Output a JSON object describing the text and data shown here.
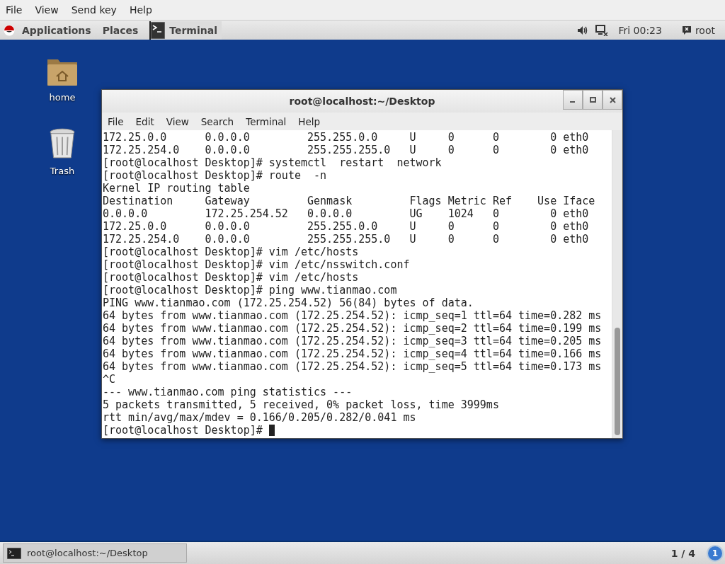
{
  "viewer_menu": [
    "File",
    "View",
    "Send key",
    "Help"
  ],
  "panel": {
    "applications": "Applications",
    "places": "Places",
    "active_app": "Terminal",
    "clock": "Fri 00:23",
    "user": "root"
  },
  "desktop_icons": [
    {
      "label": "home",
      "kind": "folder"
    },
    {
      "label": "Trash",
      "kind": "trash"
    }
  ],
  "terminal": {
    "title": "root@localhost:~/Desktop",
    "menu": [
      "File",
      "Edit",
      "View",
      "Search",
      "Terminal",
      "Help"
    ],
    "lines": [
      "172.25.0.0      0.0.0.0         255.255.0.0     U     0      0        0 eth0",
      "172.25.254.0    0.0.0.0         255.255.255.0   U     0      0        0 eth0",
      "[root@localhost Desktop]# systemctl  restart  network",
      "[root@localhost Desktop]# route  -n",
      "Kernel IP routing table",
      "Destination     Gateway         Genmask         Flags Metric Ref    Use Iface",
      "0.0.0.0         172.25.254.52   0.0.0.0         UG    1024   0        0 eth0",
      "172.25.0.0      0.0.0.0         255.255.0.0     U     0      0        0 eth0",
      "172.25.254.0    0.0.0.0         255.255.255.0   U     0      0        0 eth0",
      "[root@localhost Desktop]# vim /etc/hosts",
      "[root@localhost Desktop]# vim /etc/nsswitch.conf",
      "[root@localhost Desktop]# vim /etc/hosts",
      "[root@localhost Desktop]# ping www.tianmao.com",
      "PING www.tianmao.com (172.25.254.52) 56(84) bytes of data.",
      "64 bytes from www.tianmao.com (172.25.254.52): icmp_seq=1 ttl=64 time=0.282 ms",
      "64 bytes from www.tianmao.com (172.25.254.52): icmp_seq=2 ttl=64 time=0.199 ms",
      "64 bytes from www.tianmao.com (172.25.254.52): icmp_seq=3 ttl=64 time=0.205 ms",
      "64 bytes from www.tianmao.com (172.25.254.52): icmp_seq=4 ttl=64 time=0.166 ms",
      "64 bytes from www.tianmao.com (172.25.254.52): icmp_seq=5 ttl=64 time=0.173 ms",
      "^C",
      "--- www.tianmao.com ping statistics ---",
      "5 packets transmitted, 5 received, 0% packet loss, time 3999ms",
      "rtt min/avg/max/mdev = 0.166/0.205/0.282/0.041 ms"
    ],
    "prompt": "[root@localhost Desktop]#"
  },
  "taskbar": {
    "window": "root@localhost:~/Desktop",
    "workspace": "1 / 4",
    "notifications": "1"
  }
}
